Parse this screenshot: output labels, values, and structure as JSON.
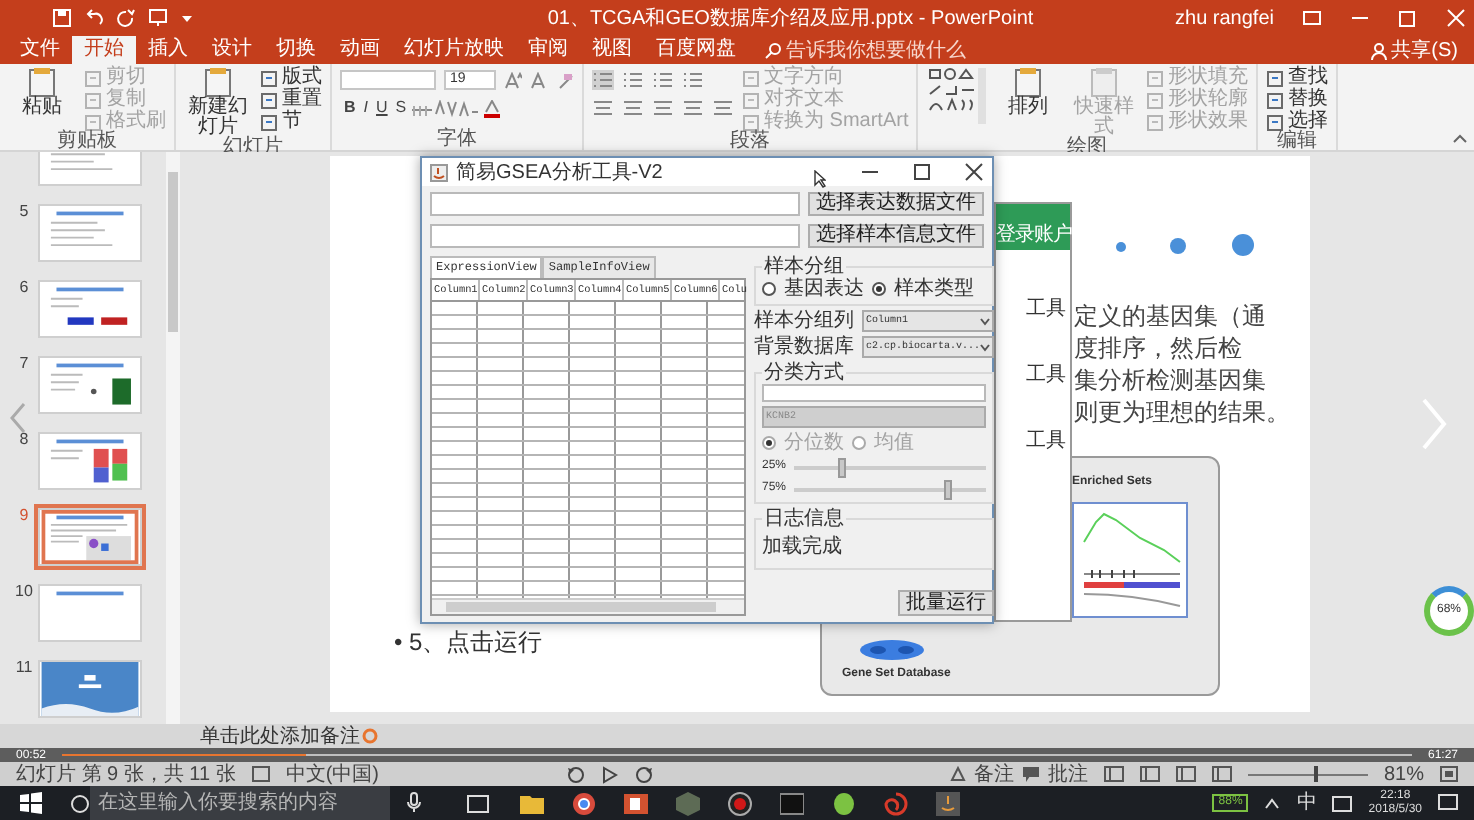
{
  "window": {
    "title": "01、TCGA和GEO数据库介绍及应用.pptx - PowerPoint",
    "user": "zhu rangfei",
    "share": "共享(S)"
  },
  "ribbon_tabs": [
    {
      "label": "文件",
      "selected": false
    },
    {
      "label": "开始",
      "selected": true
    },
    {
      "label": "插入",
      "selected": false
    },
    {
      "label": "设计",
      "selected": false
    },
    {
      "label": "切换",
      "selected": false
    },
    {
      "label": "动画",
      "selected": false
    },
    {
      "label": "幻灯片放映",
      "selected": false
    },
    {
      "label": "审阅",
      "selected": false
    },
    {
      "label": "视图",
      "selected": false
    },
    {
      "label": "百度网盘",
      "selected": false
    }
  ],
  "tell_me": {
    "placeholder": "告诉我你想要做什么"
  },
  "ribbon_groups": [
    {
      "title": "剪贴板",
      "kind": "basic",
      "large": [
        {
          "label": "粘贴",
          "disabled": false
        }
      ],
      "small": [
        {
          "label": "剪切",
          "disabled": true
        },
        {
          "label": "复制",
          "disabled": true
        },
        {
          "label": "格式刷",
          "disabled": true
        }
      ]
    },
    {
      "title": "幻灯片",
      "kind": "basic",
      "large": [
        {
          "label": "新建幻灯片",
          "disabled": false
        }
      ],
      "small": [
        {
          "label": "版式",
          "disabled": false
        },
        {
          "label": "重置",
          "disabled": false
        },
        {
          "label": "节",
          "disabled": false
        }
      ]
    },
    {
      "title": "字体",
      "kind": "font",
      "font_size": "19",
      "format_buttons": [
        "B",
        "I",
        "U",
        "S"
      ]
    },
    {
      "title": "段落",
      "kind": "paragraph",
      "small": [
        {
          "label": "文字方向",
          "disabled": true
        },
        {
          "label": "对齐文本",
          "disabled": true
        },
        {
          "label": "转换为 SmartArt",
          "disabled": true
        }
      ]
    },
    {
      "title": "绘图",
      "kind": "drawing",
      "large": [
        {
          "label": "排列",
          "disabled": false
        },
        {
          "label": "快速样式",
          "disabled": true
        }
      ],
      "small": [
        {
          "label": "形状填充",
          "disabled": true
        },
        {
          "label": "形状轮廓",
          "disabled": true
        },
        {
          "label": "形状效果",
          "disabled": true
        }
      ]
    },
    {
      "title": "编辑",
      "kind": "basic",
      "small": [
        {
          "label": "查找",
          "disabled": false
        },
        {
          "label": "替换",
          "disabled": false
        },
        {
          "label": "选择",
          "disabled": false
        }
      ]
    }
  ],
  "slides": [
    {
      "kind": "text",
      "selected": false
    },
    {
      "number": "5",
      "kind": "text",
      "selected": false
    },
    {
      "number": "6",
      "kind": "bars",
      "selected": false
    },
    {
      "number": "7",
      "kind": "image",
      "selected": false
    },
    {
      "number": "8",
      "kind": "heatmap",
      "selected": false
    },
    {
      "number": "9",
      "kind": "figure",
      "selected": true
    },
    {
      "number": "10",
      "kind": "blank",
      "selected": false
    },
    {
      "number": "11",
      "kind": "cover",
      "selected": false
    }
  ],
  "slide": {
    "paragraph_lines": [
      "定义的基因集（通",
      "度排序，然后检",
      "集分析检测基因集",
      "则更为理想的结果。"
    ],
    "figure": {
      "top_label": "Enriched Sets",
      "bottom_label": "Gene Set Database"
    },
    "bullet": "• 5、点击运行"
  },
  "background_window": {
    "header": "登录账户",
    "items": [
      "工具",
      "工具",
      "工具"
    ]
  },
  "dialog": {
    "title": "简易GSEA分析工具-V2",
    "file_buttons": [
      "选择表达数据文件",
      "选择样本信息文件"
    ],
    "tabs": [
      {
        "label": "ExpressionView",
        "selected": true
      },
      {
        "label": "SampleInfoView",
        "selected": false
      }
    ],
    "columns": [
      "Column1",
      "Column2",
      "Column3",
      "Column4",
      "Column5",
      "Column6",
      "Colu"
    ],
    "group_by": {
      "title": "样本分组",
      "options": [
        {
          "label": "基因表达",
          "checked": false
        },
        {
          "label": "样本类型",
          "checked": true
        }
      ]
    },
    "selects": [
      {
        "label": "样本分组列",
        "value": "Column1"
      },
      {
        "label": "背景数据库",
        "value": "c2.cp.biocarta.v..."
      }
    ],
    "classification": {
      "title": "分类方式",
      "disabled": true,
      "select_value": "KCNB2",
      "options": [
        {
          "label": "分位数",
          "checked": true
        },
        {
          "label": "均值",
          "checked": false
        }
      ],
      "sliders": [
        {
          "reading": "25%",
          "level": 0.25
        },
        {
          "reading": "75%",
          "level": 0.8
        }
      ]
    },
    "log": {
      "title": "日志信息",
      "text": "加载完成"
    },
    "run_button": "批量运行"
  },
  "notes": {
    "placeholder": "单击此处添加备注"
  },
  "video": {
    "elapsed": "00:52",
    "total": "61:27",
    "level": 0.18
  },
  "status_bar": {
    "slide_info": "幻灯片 第 9 张，共 11 张",
    "language": "中文(中国)",
    "notes": "备注",
    "comments": "批注",
    "zoom": {
      "reading": "81%",
      "level": 0.55
    }
  },
  "gauge": {
    "reading": "68%"
  },
  "taskbar": {
    "search": {
      "placeholder": "在这里输入你要搜索的内容"
    },
    "battery": "88%",
    "ime": "中",
    "time": "22:18",
    "date": "2018/5/30"
  }
}
